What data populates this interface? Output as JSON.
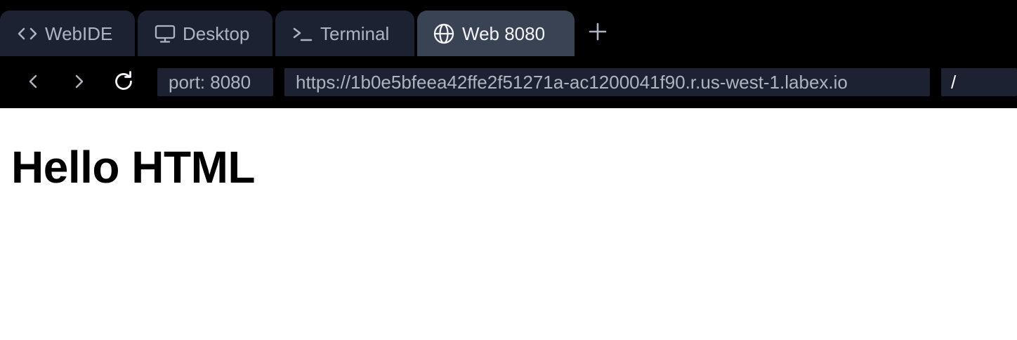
{
  "tabs": [
    {
      "label": "WebIDE",
      "icon": "code-icon"
    },
    {
      "label": "Desktop",
      "icon": "monitor-icon"
    },
    {
      "label": "Terminal",
      "icon": "terminal-icon"
    },
    {
      "label": "Web 8080",
      "icon": "globe-icon",
      "active": true
    }
  ],
  "nav": {
    "port": "port: 8080",
    "url": "https://1b0e5bfeea42ffe2f51271a-ac1200041f90.r.us-west-1.labex.io",
    "path": "/"
  },
  "page": {
    "heading": "Hello HTML"
  },
  "colors": {
    "tab_bg": "#1c2231",
    "active_tab_bg": "#3a4353",
    "bar_bg": "#000000",
    "field_bg": "#1c2231"
  }
}
